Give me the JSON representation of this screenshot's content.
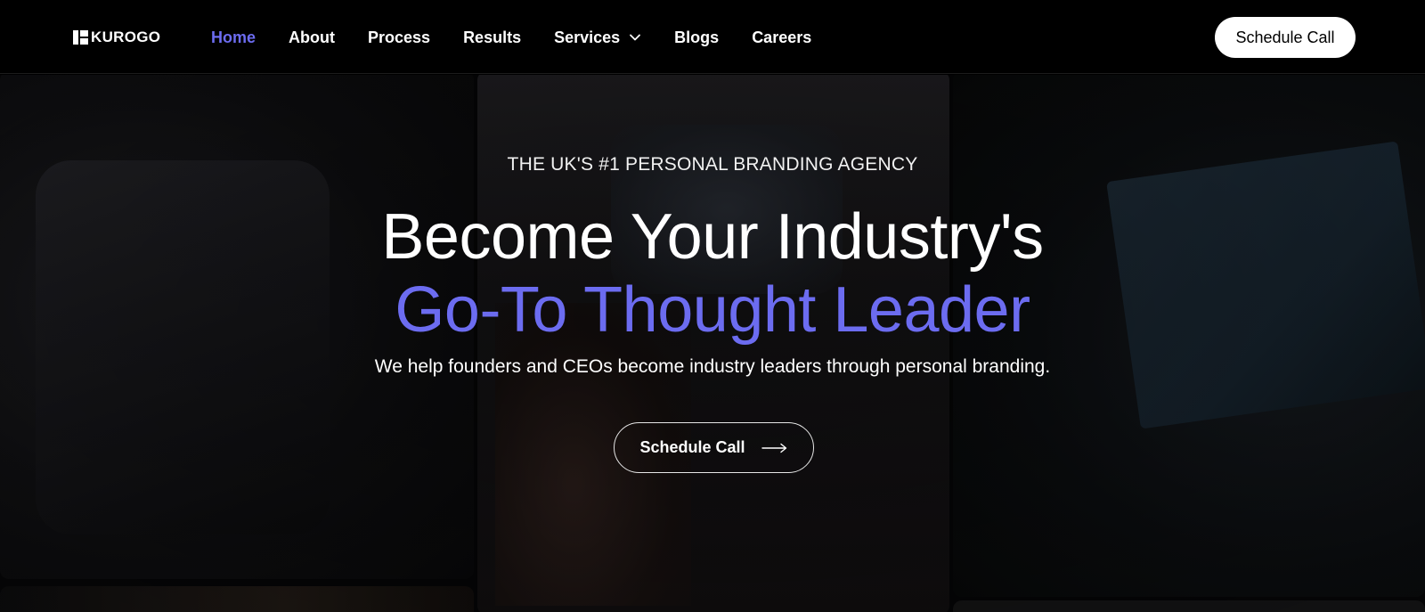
{
  "brand": {
    "name": "KUROGO"
  },
  "nav": {
    "items": [
      {
        "label": "Home",
        "active": true
      },
      {
        "label": "About"
      },
      {
        "label": "Process"
      },
      {
        "label": "Results"
      },
      {
        "label": "Services",
        "has_dropdown": true
      },
      {
        "label": "Blogs"
      },
      {
        "label": "Careers"
      }
    ],
    "cta_label": "Schedule Call"
  },
  "hero": {
    "eyebrow": "THE UK'S #1 PERSONAL BRANDING AGENCY",
    "headline_line1": "Become Your Industry's",
    "headline_line2": "Go-To Thought Leader",
    "subtitle": "We help founders and CEOs become industry leaders through personal branding.",
    "cta_label": "Schedule Call",
    "cta_icon": "arrow-right-icon"
  },
  "colors": {
    "accent": "#6c6cf0",
    "background": "#000000",
    "text": "#ffffff"
  }
}
